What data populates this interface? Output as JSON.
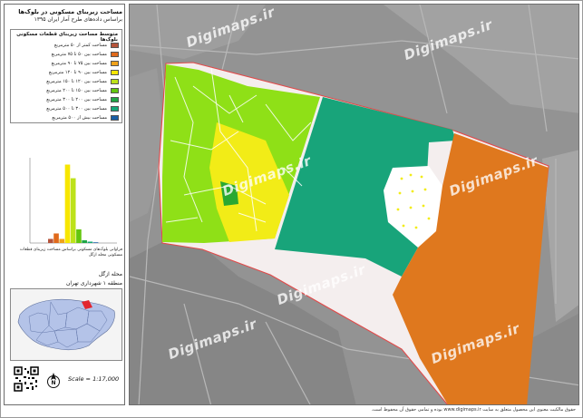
{
  "panel": {
    "title": "مساحت زیربنای مسکونی در بلوک‌ها",
    "subtitle": "براساس داده‌های طرح آمار ایران ۱۳۹۵"
  },
  "legend": {
    "title": "متوسط مساحت زیربنای قطعات مسکونی بلوک‌ها",
    "items": [
      {
        "label": "مساحت کمتر از ۵۰ مترمربع",
        "color": "#b5533a"
      },
      {
        "label": "مساحت بین ۵۰ تا ۷۵ مترمربع",
        "color": "#e06a1c"
      },
      {
        "label": "مساحت بین ۷۵ تا ۹۰ مترمربع",
        "color": "#f0a21a"
      },
      {
        "label": "مساحت بین ۹۰ تا ۱۲۰ مترمربع",
        "color": "#f7e600"
      },
      {
        "label": "مساحت بین ۱۲۰ تا ۱۵۰ مترمربع",
        "color": "#bde21a"
      },
      {
        "label": "مساحت بین ۱۵۰ تا ۲۰۰ مترمربع",
        "color": "#63c60e"
      },
      {
        "label": "مساحت بین ۲۰۰ تا ۳۰۰ مترمربع",
        "color": "#1fa546"
      },
      {
        "label": "مساحت بین ۳۰۰ تا ۵۰۰ مترمربع",
        "color": "#15a878"
      },
      {
        "label": "مساحت بیش از ۵۰۰ مترمربع",
        "color": "#1a5fa6"
      }
    ]
  },
  "chart_data": {
    "type": "bar",
    "values": [
      12,
      28,
      12,
      230,
      190,
      40,
      8,
      4,
      2
    ],
    "ylim": [
      0,
      250
    ],
    "colors": [
      "#b5533a",
      "#e06a1c",
      "#f0a21a",
      "#f7e600",
      "#bde21a",
      "#63c60e",
      "#1fa546",
      "#15a878",
      "#1a5fa6"
    ],
    "caption": "فراوانی بلوک‌های مسکونی براساس مساحت زیربنای قطعات مسکونی محله ازگل"
  },
  "location": {
    "title": "محله ازگل",
    "subtitle": "منطقه ۱ شهرداری تهران"
  },
  "scale": "Scale = 1:17,000",
  "watermark": "Digimaps.ir",
  "footer": {
    "website": "www.digimaps.ir",
    "note": "حقوق مالکیت معنوی این محصول متعلق به سایت www.digimaps.ir بوده و تمامی حقوق آن محفوظ است."
  },
  "icons": {
    "north": "north-arrow-icon",
    "qr": "qr-code-icon"
  }
}
